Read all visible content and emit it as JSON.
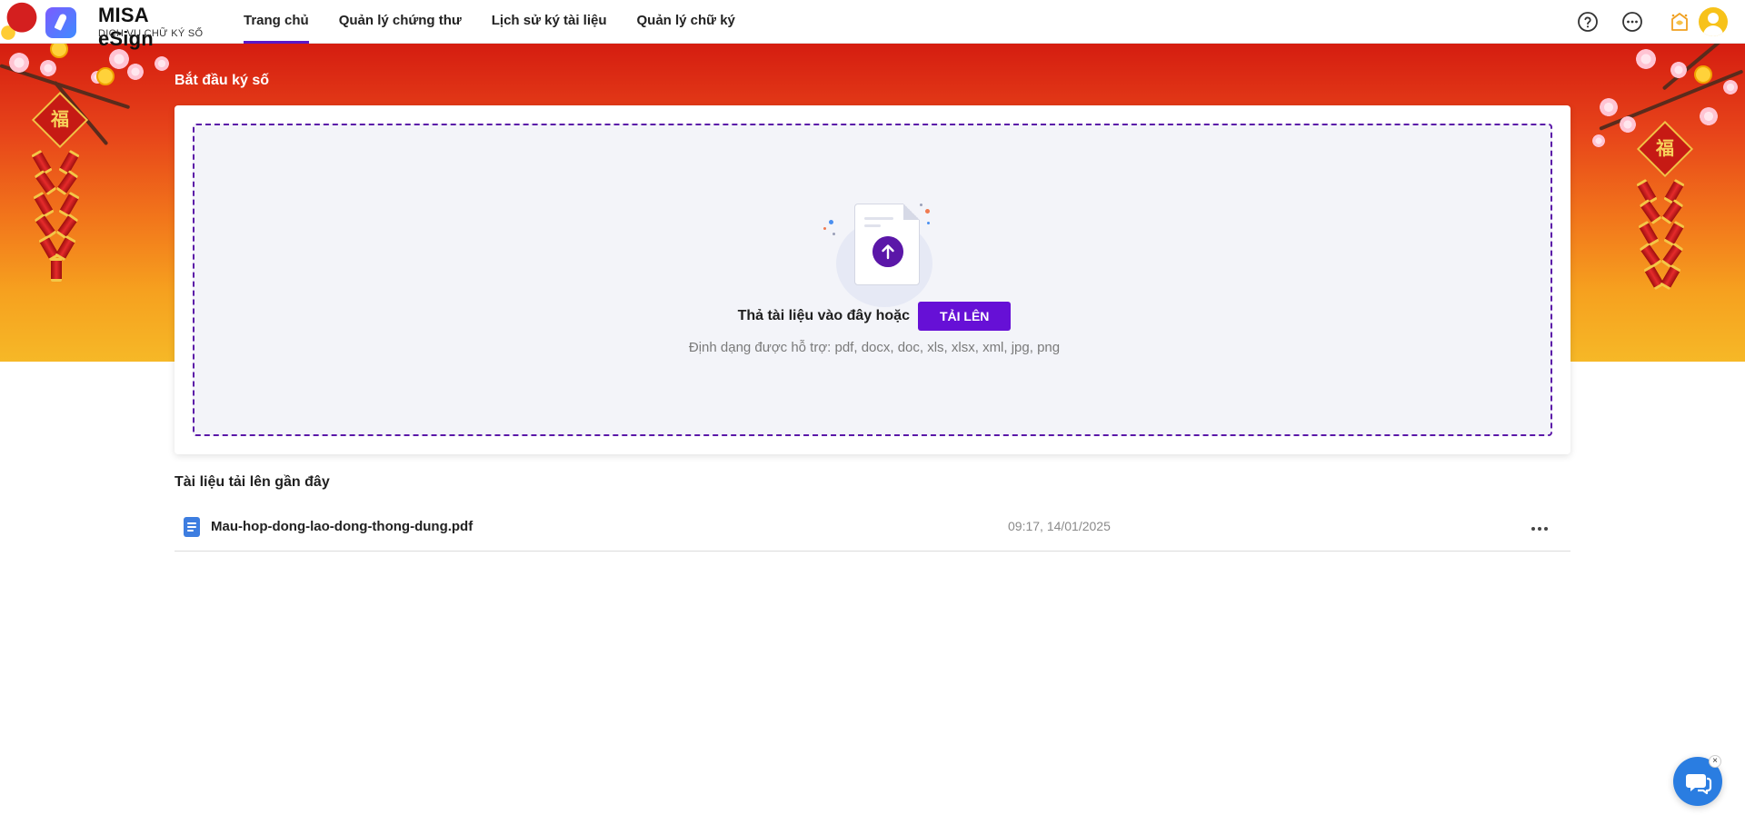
{
  "header": {
    "brand_title": "MISA eSign",
    "brand_subtitle": "DỊCH VỤ CHỮ KÝ SỐ",
    "nav": [
      {
        "label": "Trang chủ",
        "active": true
      },
      {
        "label": "Quản lý chứng thư",
        "active": false
      },
      {
        "label": "Lịch sử ký tài liệu",
        "active": false
      },
      {
        "label": "Quản lý chữ ký",
        "active": false
      }
    ],
    "icons": [
      "help-icon",
      "more-icon",
      "dragon-event-icon",
      "avatar"
    ]
  },
  "banner": {
    "title": "Bắt đầu ký số",
    "lantern_char": "福"
  },
  "upload": {
    "drop_text": "Thả tài liệu vào đây hoặc",
    "button_label": "TẢI LÊN",
    "formats_text": "Định dạng được hỗ trợ: pdf, docx, doc, xls, xlsx, xml, jpg, png"
  },
  "recent": {
    "title": "Tài liệu tải lên gần đây",
    "rows": [
      {
        "file_name": "Mau-hop-dong-lao-dong-thong-dung.pdf",
        "time": "09:17, 14/01/2025",
        "icon": "document-icon"
      }
    ]
  },
  "chat": {
    "close_label": "×"
  },
  "colors": {
    "accent": "#6610d6",
    "accent_dark": "#5b17a8",
    "banner_top": "#d51d10",
    "banner_bottom": "#f6b827",
    "chat": "#2a7de1"
  }
}
